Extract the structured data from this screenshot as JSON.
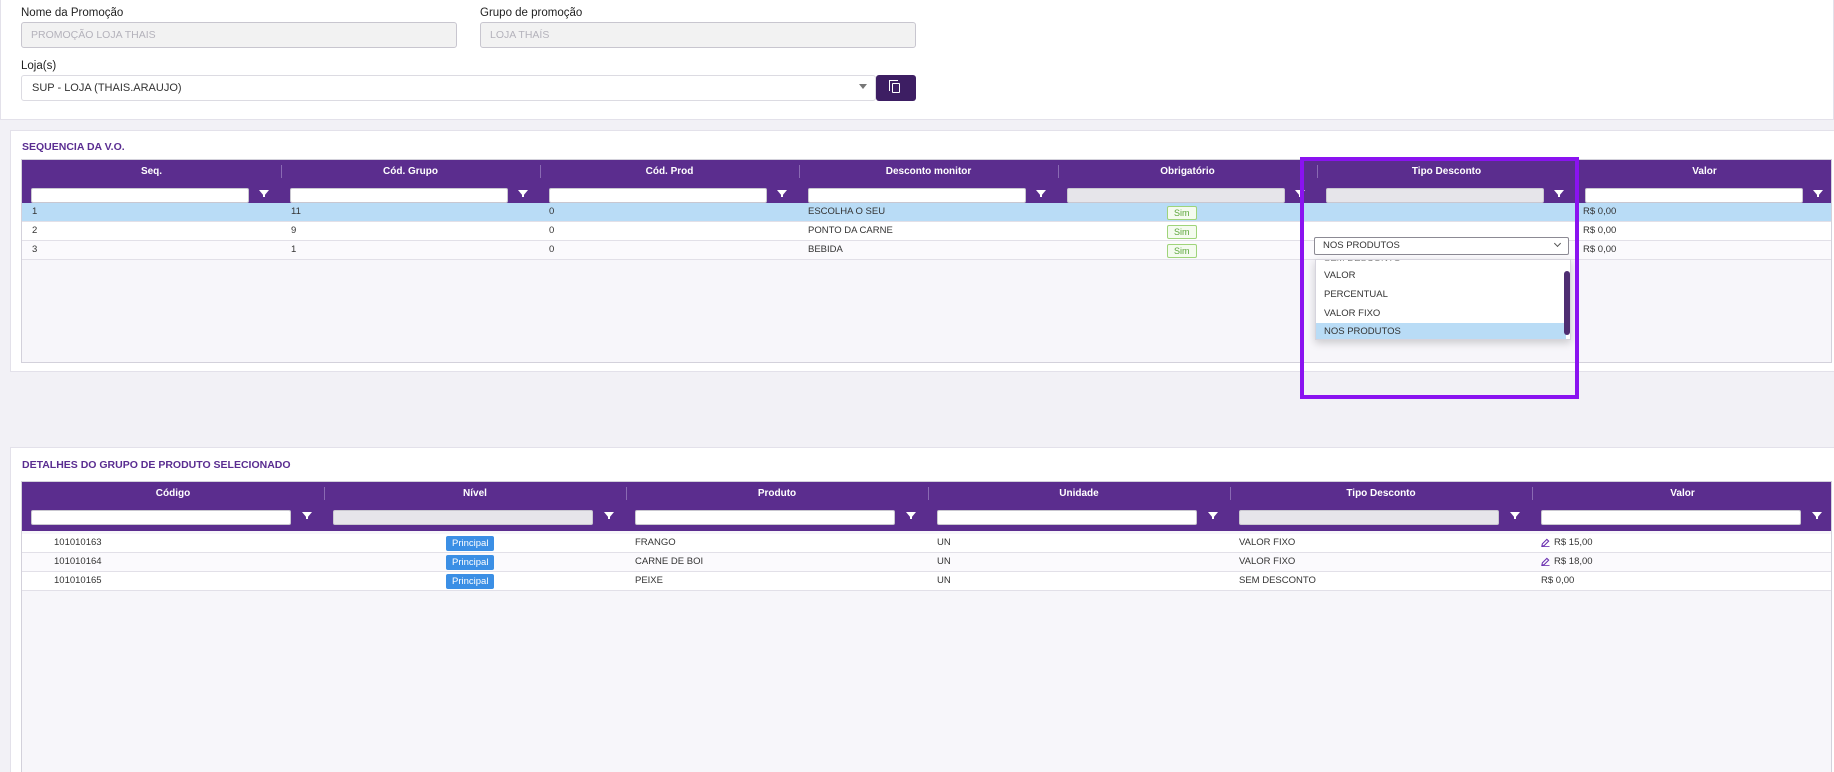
{
  "form": {
    "nome_label": "Nome da Promoção",
    "nome_value": "PROMOÇÃO LOJA THAIS",
    "grupo_label": "Grupo de promoção",
    "grupo_value": "LOJA THAÍS",
    "loja_label": "Loja(s)",
    "loja_value": "SUP - LOJA (THAIS.ARAUJO)"
  },
  "seq": {
    "title": "SEQUENCIA DA V.O.",
    "columns": [
      "Seq.",
      "Cód. Grupo",
      "Cód. Prod",
      "Desconto monitor",
      "Obrigatório",
      "Tipo Desconto",
      "Valor"
    ],
    "rows": [
      {
        "seq": "1",
        "grupo": "11",
        "prod": "0",
        "desc": "ESCOLHA O SEU",
        "obrig": "Sim",
        "tipo": "NOS PRODUTOS",
        "valor": "R$ 0,00"
      },
      {
        "seq": "2",
        "grupo": "9",
        "prod": "0",
        "desc": "PONTO DA CARNE",
        "obrig": "Sim",
        "tipo": "",
        "valor": "R$ 0,00"
      },
      {
        "seq": "3",
        "grupo": "1",
        "prod": "0",
        "desc": "BEBIDA",
        "obrig": "Sim",
        "tipo": "",
        "valor": "R$ 0,00"
      }
    ],
    "dropdown": {
      "selected": "NOS PRODUTOS",
      "options": [
        "SEM DESCONTO",
        "VALOR",
        "PERCENTUAL",
        "VALOR FIXO",
        "NOS PRODUTOS"
      ]
    }
  },
  "detalhes": {
    "title": "DETALHES DO GRUPO DE PRODUTO SELECIONADO",
    "columns": [
      "Código",
      "Nível",
      "Produto",
      "Unidade",
      "Tipo Desconto",
      "Valor"
    ],
    "rows": [
      {
        "codigo": "101010163",
        "nivel": "Principal",
        "produto": "FRANGO",
        "unidade": "UN",
        "tipo": "VALOR FIXO",
        "valor": "R$ 15,00"
      },
      {
        "codigo": "101010164",
        "nivel": "Principal",
        "produto": "CARNE DE BOI",
        "unidade": "UN",
        "tipo": "VALOR FIXO",
        "valor": "R$ 18,00"
      },
      {
        "codigo": "101010165",
        "nivel": "Principal",
        "produto": "PEIXE",
        "unidade": "UN",
        "tipo": "SEM DESCONTO",
        "valor": "R$ 0,00"
      }
    ]
  },
  "colors": {
    "header": "#5b2d8e",
    "highlight": "#8a13f0",
    "badge": "#3b8fe5",
    "selected_row": "#b9dcf6"
  },
  "icons": [
    "filter-icon",
    "copy-icon",
    "chevron-down-icon",
    "pencil-icon"
  ]
}
